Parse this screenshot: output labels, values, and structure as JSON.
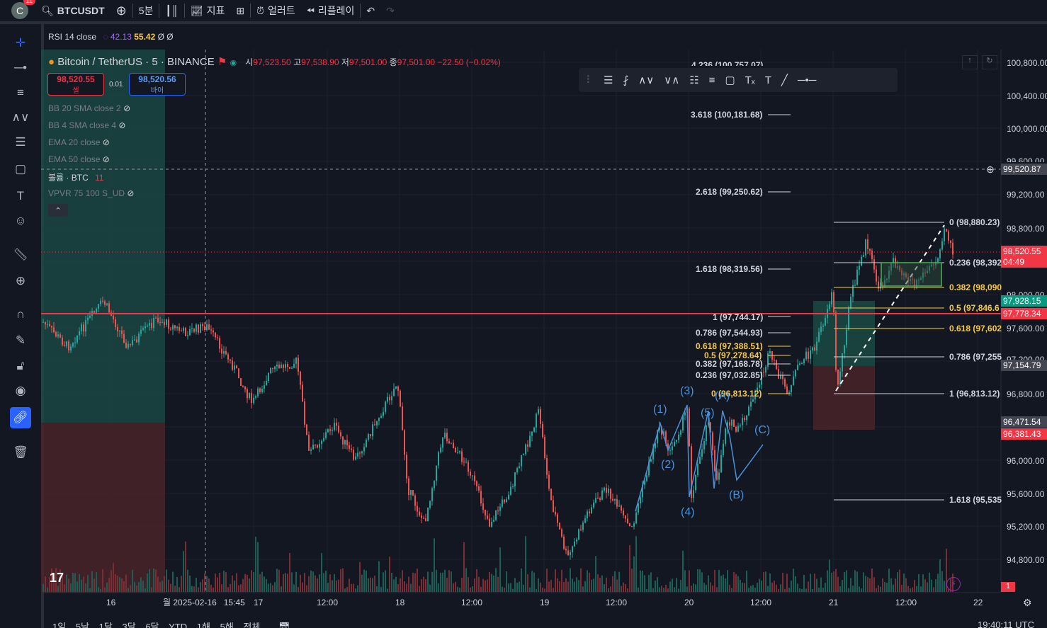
{
  "topbar": {
    "avatar_letter": "C",
    "notif_count": "11",
    "symbol": "BTCUSDT",
    "interval": "5분",
    "indicators_label": "지표",
    "alert_label": "얼러트",
    "replay_label": "리플레이"
  },
  "rsi": {
    "label": "RSI 14 close",
    "val1": "42.13",
    "val2": "55.42",
    "val3": "Ø Ø"
  },
  "symbol_header": {
    "title": "Bitcoin / TetherUS · 5 · BINANCE",
    "open_label": "시",
    "open": "97,523.50",
    "high_label": "고",
    "high": "97,538.90",
    "low_label": "저",
    "low": "97,501.00",
    "close_label": "종",
    "close": "97,501.00",
    "change": "−22.50 (−0.02%)"
  },
  "trade": {
    "sell_price": "98,520.55",
    "sell_label": "셀",
    "spread": "0.01",
    "buy_price": "98,520.56",
    "buy_label": "바이"
  },
  "indicators": [
    "BB 20 SMA close 2",
    "BB 4 SMA close 4",
    "EMA 20 close",
    "EMA 50 close",
    "볼륨 · BTC",
    "VPVR 75 100 S_UD"
  ],
  "volume_value": "11",
  "price_axis": [
    "100,800.00",
    "100,400.00",
    "100,000.00",
    "99,600.00",
    "99,200.00",
    "98,800.00",
    "98,000.00",
    "97,600.00",
    "97,200.00",
    "96,800.00",
    "96,000.00",
    "95,600.00",
    "95,200.00",
    "94,800.00"
  ],
  "price_labels": [
    {
      "text": "99,520.87",
      "bg": "#434651"
    },
    {
      "text": "98,520.55",
      "bg": "#f23645"
    },
    {
      "text": "04:49",
      "bg": "#f23645"
    },
    {
      "text": "97,928.15",
      "bg": "#089981"
    },
    {
      "text": "97,778.34",
      "bg": "#f23645"
    },
    {
      "text": "97,154.79",
      "bg": "#434651"
    },
    {
      "text": "96,471.54",
      "bg": "#434651"
    },
    {
      "text": "96,381.43",
      "bg": "#f23645"
    }
  ],
  "time_axis": [
    "16",
    "17",
    "12:00",
    "18",
    "12:00",
    "19",
    "12:00",
    "20",
    "12:00",
    "21",
    "12:00",
    "22"
  ],
  "cursor_time": "월 2025-02-16   15:45",
  "fib_left": [
    {
      "text": "4.236 (100,757.07)",
      "color": "#d1d4dc"
    },
    {
      "text": "3.618 (100,181.68)",
      "color": "#d1d4dc"
    },
    {
      "text": "2.618 (99,250.62)",
      "color": "#d1d4dc"
    },
    {
      "text": "1.618 (98,319.56)",
      "color": "#d1d4dc"
    },
    {
      "text": "1 (97,744.17)",
      "color": "#d1d4dc"
    },
    {
      "text": "0.786 (97,544.93)",
      "color": "#d1d4dc"
    },
    {
      "text": "0.618 (97,388.51)",
      "color": "#f7c948"
    },
    {
      "text": "0.5 (97,278.64)",
      "color": "#f7c948"
    },
    {
      "text": "0.382 (97,168.78)",
      "color": "#d1d4dc"
    },
    {
      "text": "0.236 (97,032.85)",
      "color": "#d1d4dc"
    },
    {
      "text": "0 (96,813.12)",
      "color": "#f7c948"
    }
  ],
  "fib_right": [
    {
      "text": "0 (98,880.23)",
      "color": "#d1d4dc"
    },
    {
      "text": "0.236 (98,392",
      "color": "#d1d4dc"
    },
    {
      "text": "0.382 (98,090",
      "color": "#f7c948"
    },
    {
      "text": "0.5 (97,846.6",
      "color": "#f7c948"
    },
    {
      "text": "0.618 (97,602",
      "color": "#f7c948"
    },
    {
      "text": "0.786 (97,255",
      "color": "#d1d4dc"
    },
    {
      "text": "1 (96,813.12)",
      "color": "#d1d4dc"
    },
    {
      "text": "1.618 (95,535",
      "color": "#d1d4dc"
    }
  ],
  "waves": [
    "(1)",
    "(2)",
    "(3)",
    "(4)",
    "(5)",
    "(A)",
    "(B)",
    "(C)"
  ],
  "bottom": {
    "periods": [
      "1일",
      "5날",
      "1달",
      "3달",
      "6달",
      "YTD",
      "1해",
      "5해",
      "전체"
    ],
    "clock": "19:40:11 UTC"
  },
  "alert_badge": "1",
  "colors": {
    "bg": "#131722",
    "up": "#26a69a",
    "down": "#ef5350",
    "accent": "#2962ff",
    "fib_yellow": "#f7c948",
    "wave": "#4a90d9"
  }
}
